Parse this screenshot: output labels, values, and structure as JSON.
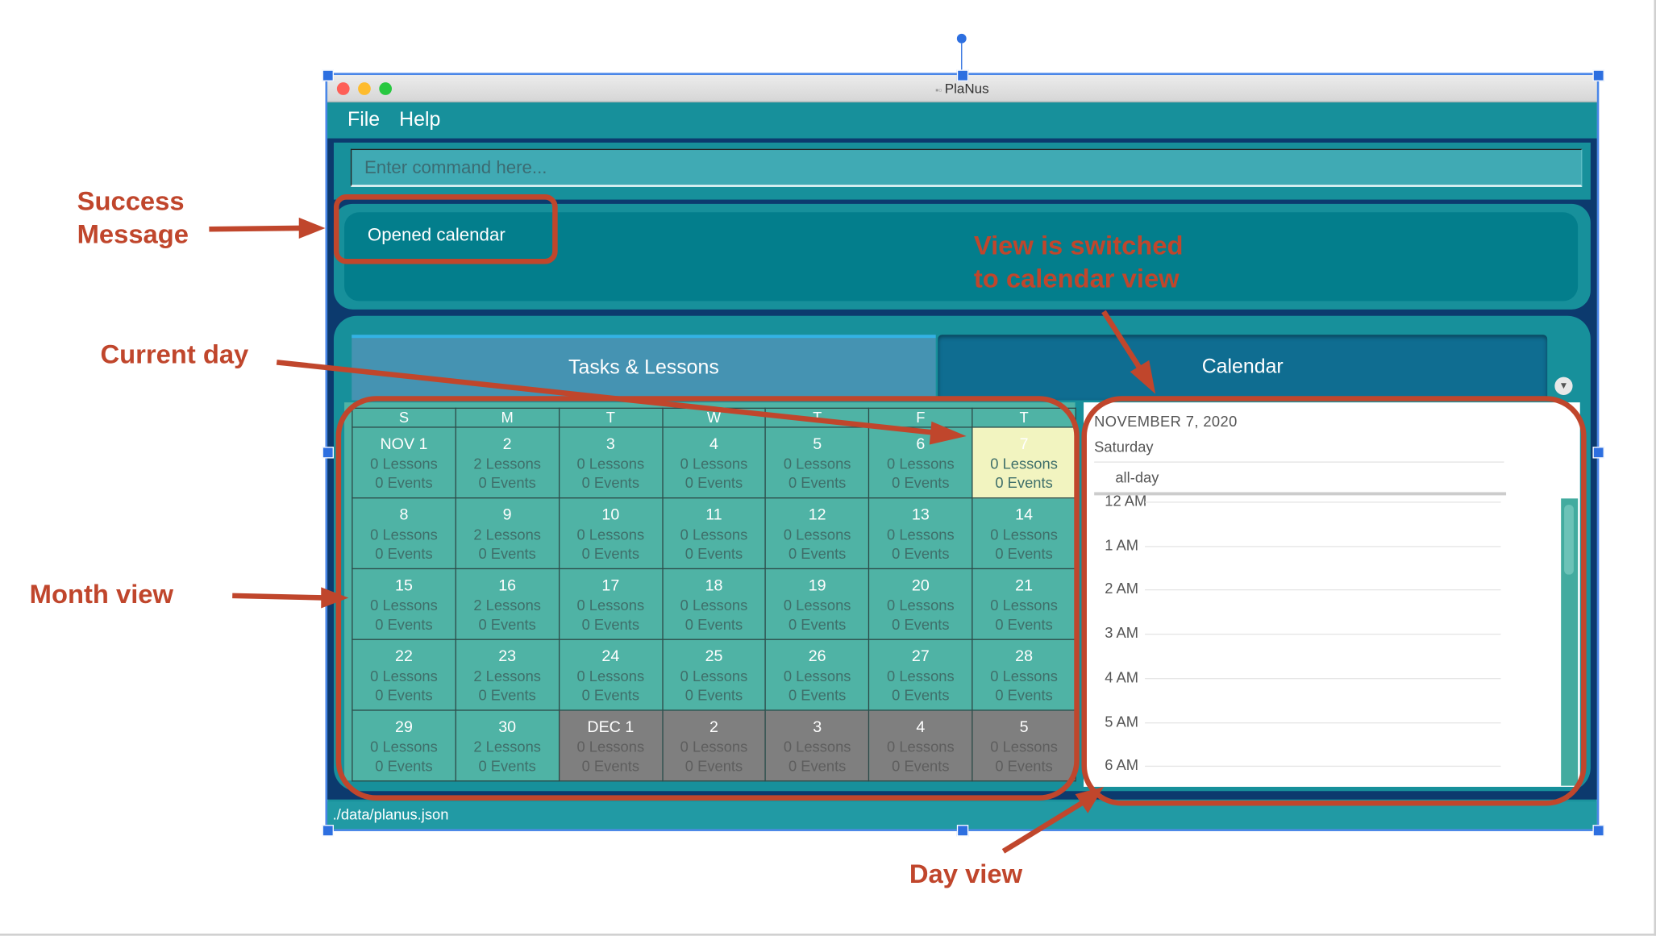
{
  "window": {
    "title": "PlaNus"
  },
  "menu": {
    "items": [
      "File",
      "Help"
    ]
  },
  "command": {
    "placeholder": "Enter command here..."
  },
  "result": {
    "message": "Opened calendar"
  },
  "tabs": [
    {
      "label": "Tasks & Lessons",
      "selected": false
    },
    {
      "label": "Calendar",
      "selected": true
    }
  ],
  "month": {
    "headers": [
      "S",
      "M",
      "T",
      "W",
      "T",
      "F",
      "T"
    ],
    "weeks": [
      [
        {
          "d": "NOV 1",
          "l": "0 Lessons",
          "e": "0 Events"
        },
        {
          "d": "2",
          "l": "2 Lessons",
          "e": "0 Events"
        },
        {
          "d": "3",
          "l": "0 Lessons",
          "e": "0 Events"
        },
        {
          "d": "4",
          "l": "0 Lessons",
          "e": "0 Events"
        },
        {
          "d": "5",
          "l": "0 Lessons",
          "e": "0 Events"
        },
        {
          "d": "6",
          "l": "0 Lessons",
          "e": "0 Events"
        },
        {
          "d": "7",
          "l": "0 Lessons",
          "e": "0 Events",
          "today": true
        }
      ],
      [
        {
          "d": "8",
          "l": "0 Lessons",
          "e": "0 Events"
        },
        {
          "d": "9",
          "l": "2 Lessons",
          "e": "0 Events"
        },
        {
          "d": "10",
          "l": "0 Lessons",
          "e": "0 Events"
        },
        {
          "d": "11",
          "l": "0 Lessons",
          "e": "0 Events"
        },
        {
          "d": "12",
          "l": "0 Lessons",
          "e": "0 Events"
        },
        {
          "d": "13",
          "l": "0 Lessons",
          "e": "0 Events"
        },
        {
          "d": "14",
          "l": "0 Lessons",
          "e": "0 Events"
        }
      ],
      [
        {
          "d": "15",
          "l": "0 Lessons",
          "e": "0 Events"
        },
        {
          "d": "16",
          "l": "2 Lessons",
          "e": "0 Events"
        },
        {
          "d": "17",
          "l": "0 Lessons",
          "e": "0 Events"
        },
        {
          "d": "18",
          "l": "0 Lessons",
          "e": "0 Events"
        },
        {
          "d": "19",
          "l": "0 Lessons",
          "e": "0 Events"
        },
        {
          "d": "20",
          "l": "0 Lessons",
          "e": "0 Events"
        },
        {
          "d": "21",
          "l": "0 Lessons",
          "e": "0 Events"
        }
      ],
      [
        {
          "d": "22",
          "l": "0 Lessons",
          "e": "0 Events"
        },
        {
          "d": "23",
          "l": "2 Lessons",
          "e": "0 Events"
        },
        {
          "d": "24",
          "l": "0 Lessons",
          "e": "0 Events"
        },
        {
          "d": "25",
          "l": "0 Lessons",
          "e": "0 Events"
        },
        {
          "d": "26",
          "l": "0 Lessons",
          "e": "0 Events"
        },
        {
          "d": "27",
          "l": "0 Lessons",
          "e": "0 Events"
        },
        {
          "d": "28",
          "l": "0 Lessons",
          "e": "0 Events"
        }
      ],
      [
        {
          "d": "29",
          "l": "0 Lessons",
          "e": "0 Events"
        },
        {
          "d": "30",
          "l": "2 Lessons",
          "e": "0 Events"
        },
        {
          "d": "DEC 1",
          "l": "0 Lessons",
          "e": "0 Events",
          "other": true
        },
        {
          "d": "2",
          "l": "0 Lessons",
          "e": "0 Events",
          "other": true
        },
        {
          "d": "3",
          "l": "0 Lessons",
          "e": "0 Events",
          "other": true
        },
        {
          "d": "4",
          "l": "0 Lessons",
          "e": "0 Events",
          "other": true
        },
        {
          "d": "5",
          "l": "0 Lessons",
          "e": "0 Events",
          "other": true
        }
      ]
    ]
  },
  "day": {
    "date": "NOVEMBER 7, 2020",
    "weekday": "Saturday",
    "allday_label": "all-day",
    "hours": [
      "12 AM",
      "1 AM",
      "2 AM",
      "3 AM",
      "4 AM",
      "5 AM",
      "6 AM"
    ]
  },
  "status": {
    "path": "./data/planus.json"
  },
  "annotations": {
    "success": "Success\nMessage",
    "switched": "View is switched\nto calendar view",
    "current_day": "Current day",
    "month_view": "Month view",
    "day_view": "Day view"
  },
  "colors": {
    "annotation": "#c0462c",
    "teal": "#17909b",
    "today": "#f2f4c0",
    "cell": "#4fb3a5"
  }
}
